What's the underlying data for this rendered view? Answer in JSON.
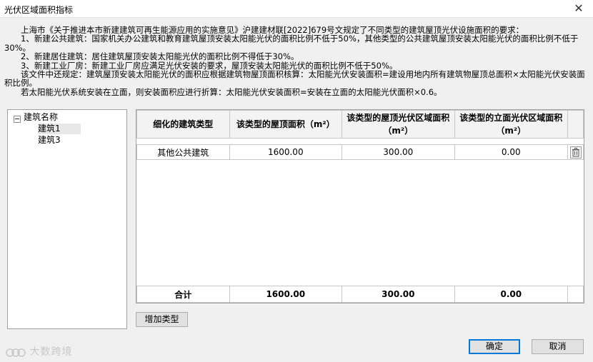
{
  "window": {
    "title": "光伏区域面积指标",
    "close_glyph": "✕"
  },
  "description": [
    "　　上海市《关于推进本市新建建筑可再生能源应用的实施意见》沪建建材联[2022]679号文规定了不同类型的建筑屋顶光伏设施面积的要求：",
    "　　1、新建公共建筑：国家机关办公建筑和教育建筑屋顶安装太阳能光伏的面积比例不低于50%，其他类型的公共建筑屋顶安装太阳能光伏的面积比例不低于30%。",
    "　　2、新建居住建筑：居住建筑屋顶安装太阳能光伏的面积比例不得低于30%。",
    "　　3、新建工业厂房：新建工业厂房应满足光伏安装的要求，屋顶安装太阳能光伏的面积比例不低于50%。",
    "　　该文件中还规定：建筑屋顶安装太阳能光伏的面积应根据建筑物屋顶面积核算：太阳能光伏安装面积=建设用地内所有建筑物屋顶总面积×太阳能光伏安装面积比例。",
    "　　若太阳能光伏系统安装在立面，则安装面积应进行折算：太阳能光伏安装面积=安装在立面的太阳能光伏面积×0.6。"
  ],
  "tree": {
    "root": "建筑名称",
    "items": [
      "建筑1",
      "建筑3"
    ],
    "selected_index": 0
  },
  "table": {
    "headers": [
      "细化的建筑类型",
      "该类型的屋顶面积（m²）",
      "该类型的屋顶光伏区域面积（m²）",
      "该类型的立面光伏区域面积（m²）"
    ],
    "rows": [
      [
        "其他公共建筑",
        "1600.00",
        "300.00",
        "0.00"
      ]
    ],
    "delete_icon": "trash-icon",
    "total": [
      "合计",
      "1600.00",
      "300.00",
      "0.00"
    ]
  },
  "buttons": {
    "add_type": "增加类型",
    "ok": "确定",
    "cancel": "取消"
  },
  "watermark": "大数跨境",
  "colors": {
    "primary_border": "#0078d7",
    "grid_border": "#c8c8c8"
  }
}
